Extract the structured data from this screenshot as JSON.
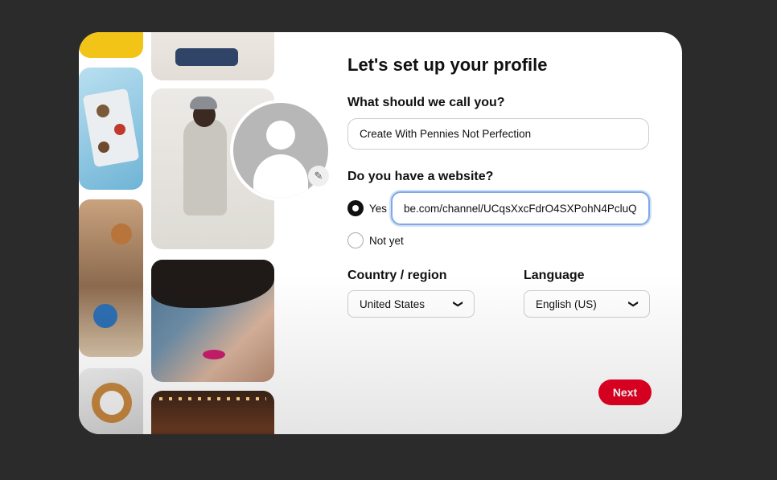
{
  "form": {
    "title": "Let's set up your profile",
    "name_label": "What should we call you?",
    "name_value": "Create With Pennies Not Perfection",
    "website_label": "Do you have a website?",
    "website_yes_label": "Yes",
    "website_no_label": "Not yet",
    "website_value": "be.com/channel/UCqsXxcFdrO4SXPohN4PcluQ",
    "country_label": "Country / region",
    "country_value": "United States",
    "language_label": "Language",
    "language_value": "English (US)",
    "next_label": "Next"
  },
  "icons": {
    "avatar": "user-silhouette-icon",
    "edit": "pencil-icon",
    "dropdown": "chevron-down-icon"
  },
  "colors": {
    "accent": "#e60023",
    "focus_ring": "#7fa9e6",
    "background": "#2b2b2b"
  }
}
